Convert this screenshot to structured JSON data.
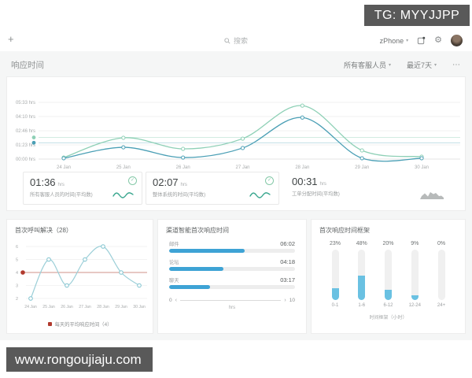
{
  "overlay": {
    "tg_badge": "TG: MYYJJPP",
    "watermark": "www.rongoujiaju.com"
  },
  "icons": {
    "plus": "+",
    "chevron_down": "▾",
    "more": "⋯",
    "check": "✓",
    "gear": "⚙",
    "arrow_left": "‹",
    "arrow_right": "›"
  },
  "navbar": {
    "search_placeholder": "搜索",
    "phone_label": "zPhone"
  },
  "header": {
    "title": "响应时间",
    "agent_filter": "所有客服人员",
    "date_filter": "最近7天"
  },
  "kpis": [
    {
      "value": "01:36",
      "unit": "hrs",
      "label": "所有客服人员的时间(平均数)"
    },
    {
      "value": "02:07",
      "unit": "hrs",
      "label": "整体系统的时间(平均数)"
    },
    {
      "value": "00:31",
      "unit": "hrs",
      "label": "工单分配时间(平均数)"
    }
  ],
  "chart_data": [
    {
      "id": "response-time",
      "type": "line",
      "title": "响应时间",
      "x": [
        "24 Jan",
        "25 Jan",
        "26 Jan",
        "27 Jan",
        "28 Jan",
        "29 Jan",
        "30 Jan"
      ],
      "y_ticks": [
        "05:33 hrs",
        "04:10 hrs",
        "02:46 hrs",
        "01:23 hrs",
        "00:00 hrs"
      ],
      "ylim_minutes": [
        0,
        333
      ],
      "grid": true,
      "series": [
        {
          "name": "整体系统的时间(平均数)",
          "color": "#8ed0b6",
          "values_minutes": [
            9,
            125,
            60,
            120,
            314,
            51,
            14
          ],
          "average_minutes": 127,
          "average_label": "02:07"
        },
        {
          "name": "所有客服人员的时间(平均数)",
          "color": "#4a9fb5",
          "values_minutes": [
            5,
            69,
            9,
            65,
            244,
            5,
            5
          ],
          "average_minutes": 96,
          "average_label": "01:36"
        }
      ]
    },
    {
      "id": "first-call-resolution",
      "type": "line",
      "title": "首次呼叫解决（28）",
      "x": [
        "24 Jan",
        "25 Jan",
        "26 Jan",
        "27 Jan",
        "28 Jan",
        "29 Jan",
        "30 Jan"
      ],
      "y_ticks": [
        6,
        5,
        4,
        3,
        2
      ],
      "ylim": [
        2,
        6
      ],
      "average": 4,
      "average_color": "#b13a2e",
      "legend": "每天的平均响应时间（4）",
      "series": [
        {
          "name": "首次呼叫解决",
          "color": "#9ccfd8",
          "values": [
            2,
            5,
            3,
            5,
            6,
            4,
            3
          ]
        }
      ]
    },
    {
      "id": "channel-first-response",
      "type": "bar-horizontal",
      "title": "渠道智能首次响应时间",
      "categories": [
        "邮件",
        "论坛",
        "聊天"
      ],
      "value_labels": [
        "06:02",
        "04:18",
        "03:17"
      ],
      "values_hours": [
        6.03,
        4.3,
        3.28
      ],
      "xlim": [
        0,
        10
      ],
      "x_ticks": [
        "0",
        "10"
      ],
      "xlabel": "hrs",
      "bar_color": "#3ea3d5"
    },
    {
      "id": "first-response-frame",
      "type": "bar",
      "title": "首次响应时间框架",
      "categories": [
        "0-1",
        "1-6",
        "6-12",
        "12-24",
        "24+"
      ],
      "value_labels": [
        "23%",
        "48%",
        "20%",
        "9%",
        "0%"
      ],
      "values_percent": [
        23,
        48,
        20,
        9,
        0
      ],
      "ylim": [
        0,
        100
      ],
      "xlabel": "时间框架（小时）",
      "bar_color": "#6ac1e2"
    }
  ]
}
